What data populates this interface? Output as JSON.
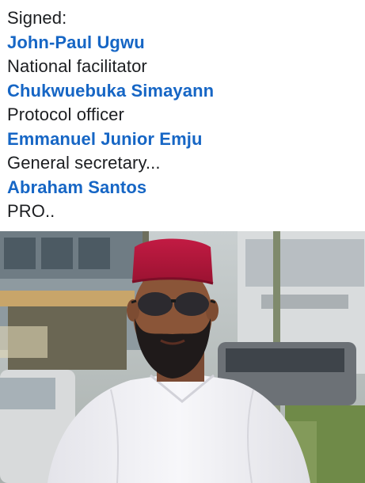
{
  "post": {
    "signed_label": "Signed:",
    "signatories": [
      {
        "name": "John-Paul Ugwu",
        "role": "National facilitator"
      },
      {
        "name": "Chukwuebuka Simayann",
        "role": "Protocol officer"
      },
      {
        "name": "Emmanuel Junior Emju",
        "role": "General secretary..."
      },
      {
        "name": "Abraham Santos",
        "role": "PRO.."
      }
    ]
  },
  "colors": {
    "name_link": "#1666c5",
    "body_text": "#1c1e21",
    "cap": "#b5163a",
    "shirt": "#f2f2f5"
  },
  "photo": {
    "icon": "photo-of-man-in-red-cap-and-sunglasses"
  }
}
